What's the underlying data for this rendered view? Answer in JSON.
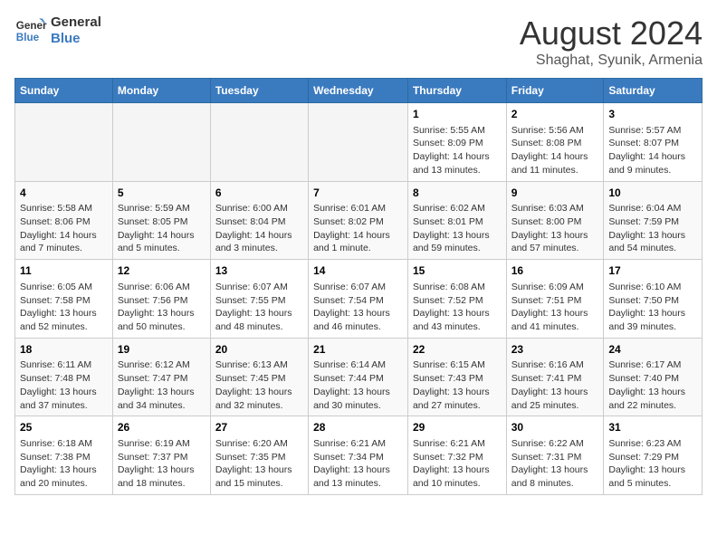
{
  "header": {
    "logo_line1": "General",
    "logo_line2": "Blue",
    "main_title": "August 2024",
    "sub_title": "Shaghat, Syunik, Armenia"
  },
  "weekdays": [
    "Sunday",
    "Monday",
    "Tuesday",
    "Wednesday",
    "Thursday",
    "Friday",
    "Saturday"
  ],
  "weeks": [
    [
      {
        "day": "",
        "info": ""
      },
      {
        "day": "",
        "info": ""
      },
      {
        "day": "",
        "info": ""
      },
      {
        "day": "",
        "info": ""
      },
      {
        "day": "1",
        "info": "Sunrise: 5:55 AM\nSunset: 8:09 PM\nDaylight: 14 hours\nand 13 minutes."
      },
      {
        "day": "2",
        "info": "Sunrise: 5:56 AM\nSunset: 8:08 PM\nDaylight: 14 hours\nand 11 minutes."
      },
      {
        "day": "3",
        "info": "Sunrise: 5:57 AM\nSunset: 8:07 PM\nDaylight: 14 hours\nand 9 minutes."
      }
    ],
    [
      {
        "day": "4",
        "info": "Sunrise: 5:58 AM\nSunset: 8:06 PM\nDaylight: 14 hours\nand 7 minutes."
      },
      {
        "day": "5",
        "info": "Sunrise: 5:59 AM\nSunset: 8:05 PM\nDaylight: 14 hours\nand 5 minutes."
      },
      {
        "day": "6",
        "info": "Sunrise: 6:00 AM\nSunset: 8:04 PM\nDaylight: 14 hours\nand 3 minutes."
      },
      {
        "day": "7",
        "info": "Sunrise: 6:01 AM\nSunset: 8:02 PM\nDaylight: 14 hours\nand 1 minute."
      },
      {
        "day": "8",
        "info": "Sunrise: 6:02 AM\nSunset: 8:01 PM\nDaylight: 13 hours\nand 59 minutes."
      },
      {
        "day": "9",
        "info": "Sunrise: 6:03 AM\nSunset: 8:00 PM\nDaylight: 13 hours\nand 57 minutes."
      },
      {
        "day": "10",
        "info": "Sunrise: 6:04 AM\nSunset: 7:59 PM\nDaylight: 13 hours\nand 54 minutes."
      }
    ],
    [
      {
        "day": "11",
        "info": "Sunrise: 6:05 AM\nSunset: 7:58 PM\nDaylight: 13 hours\nand 52 minutes."
      },
      {
        "day": "12",
        "info": "Sunrise: 6:06 AM\nSunset: 7:56 PM\nDaylight: 13 hours\nand 50 minutes."
      },
      {
        "day": "13",
        "info": "Sunrise: 6:07 AM\nSunset: 7:55 PM\nDaylight: 13 hours\nand 48 minutes."
      },
      {
        "day": "14",
        "info": "Sunrise: 6:07 AM\nSunset: 7:54 PM\nDaylight: 13 hours\nand 46 minutes."
      },
      {
        "day": "15",
        "info": "Sunrise: 6:08 AM\nSunset: 7:52 PM\nDaylight: 13 hours\nand 43 minutes."
      },
      {
        "day": "16",
        "info": "Sunrise: 6:09 AM\nSunset: 7:51 PM\nDaylight: 13 hours\nand 41 minutes."
      },
      {
        "day": "17",
        "info": "Sunrise: 6:10 AM\nSunset: 7:50 PM\nDaylight: 13 hours\nand 39 minutes."
      }
    ],
    [
      {
        "day": "18",
        "info": "Sunrise: 6:11 AM\nSunset: 7:48 PM\nDaylight: 13 hours\nand 37 minutes."
      },
      {
        "day": "19",
        "info": "Sunrise: 6:12 AM\nSunset: 7:47 PM\nDaylight: 13 hours\nand 34 minutes."
      },
      {
        "day": "20",
        "info": "Sunrise: 6:13 AM\nSunset: 7:45 PM\nDaylight: 13 hours\nand 32 minutes."
      },
      {
        "day": "21",
        "info": "Sunrise: 6:14 AM\nSunset: 7:44 PM\nDaylight: 13 hours\nand 30 minutes."
      },
      {
        "day": "22",
        "info": "Sunrise: 6:15 AM\nSunset: 7:43 PM\nDaylight: 13 hours\nand 27 minutes."
      },
      {
        "day": "23",
        "info": "Sunrise: 6:16 AM\nSunset: 7:41 PM\nDaylight: 13 hours\nand 25 minutes."
      },
      {
        "day": "24",
        "info": "Sunrise: 6:17 AM\nSunset: 7:40 PM\nDaylight: 13 hours\nand 22 minutes."
      }
    ],
    [
      {
        "day": "25",
        "info": "Sunrise: 6:18 AM\nSunset: 7:38 PM\nDaylight: 13 hours\nand 20 minutes."
      },
      {
        "day": "26",
        "info": "Sunrise: 6:19 AM\nSunset: 7:37 PM\nDaylight: 13 hours\nand 18 minutes."
      },
      {
        "day": "27",
        "info": "Sunrise: 6:20 AM\nSunset: 7:35 PM\nDaylight: 13 hours\nand 15 minutes."
      },
      {
        "day": "28",
        "info": "Sunrise: 6:21 AM\nSunset: 7:34 PM\nDaylight: 13 hours\nand 13 minutes."
      },
      {
        "day": "29",
        "info": "Sunrise: 6:21 AM\nSunset: 7:32 PM\nDaylight: 13 hours\nand 10 minutes."
      },
      {
        "day": "30",
        "info": "Sunrise: 6:22 AM\nSunset: 7:31 PM\nDaylight: 13 hours\nand 8 minutes."
      },
      {
        "day": "31",
        "info": "Sunrise: 6:23 AM\nSunset: 7:29 PM\nDaylight: 13 hours\nand 5 minutes."
      }
    ]
  ]
}
